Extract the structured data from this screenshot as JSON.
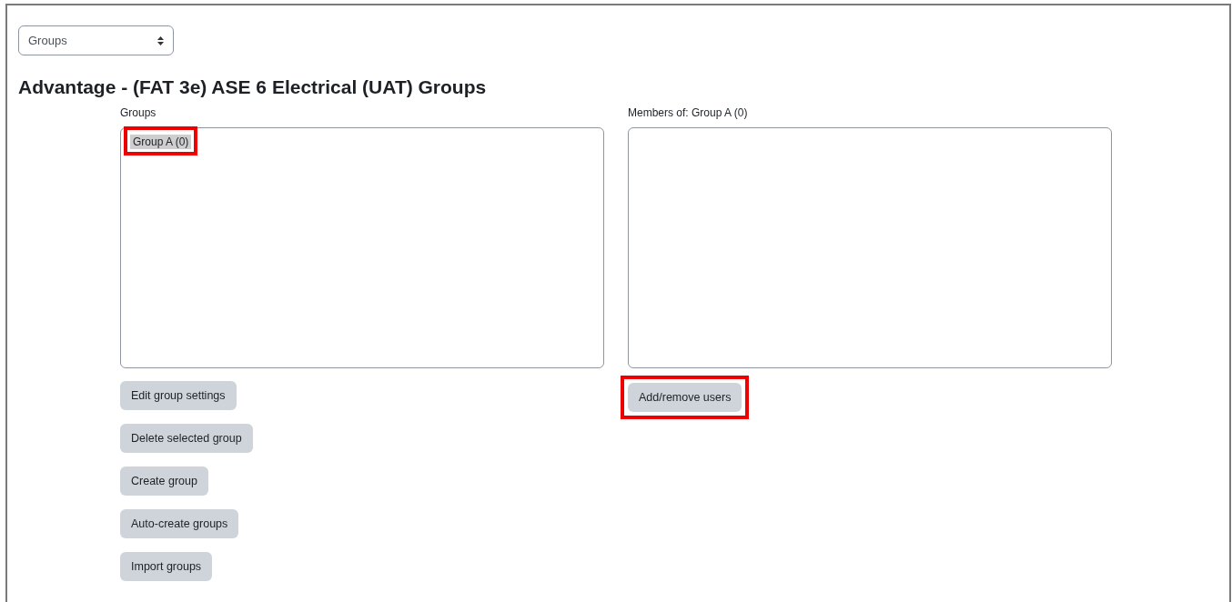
{
  "view_select": {
    "value": "Groups"
  },
  "title": "Advantage - (FAT 3e) ASE 6 Electrical (UAT) Groups",
  "groups_panel": {
    "label": "Groups",
    "items": [
      {
        "text": "Group A (0)",
        "selected": true,
        "highlighted": true
      }
    ],
    "buttons": [
      {
        "label": "Edit group settings",
        "highlighted": false
      },
      {
        "label": "Delete selected group",
        "highlighted": false
      },
      {
        "label": "Create group",
        "highlighted": false
      },
      {
        "label": "Auto-create groups",
        "highlighted": false
      },
      {
        "label": "Import groups",
        "highlighted": false
      }
    ]
  },
  "members_panel": {
    "label": "Members of: Group A (0)",
    "buttons": [
      {
        "label": "Add/remove users",
        "highlighted": true
      }
    ]
  }
}
